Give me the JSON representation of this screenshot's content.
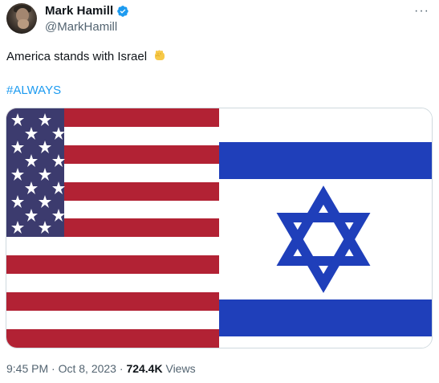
{
  "user": {
    "display_name": "Mark Hamill",
    "handle": "@MarkHamill",
    "verified_icon": "verified-badge-icon"
  },
  "tweet": {
    "text": "America stands with Israel",
    "emoji": "raised-fist-emoji",
    "hashtag": "#ALWAYS"
  },
  "more_menu": {
    "label": "···"
  },
  "media": {
    "left_image": "us-flag",
    "right_image": "israel-flag"
  },
  "meta": {
    "time": "9:45 PM",
    "separator": "·",
    "date": "Oct 8, 2023",
    "views_count": "724.4K",
    "views_label": "Views"
  },
  "colors": {
    "verified_blue": "#1d9bf0",
    "hashtag_blue": "#1d9bf0",
    "us_red": "#b22234",
    "us_blue": "#3c3b6e",
    "israel_blue": "#1f3fba",
    "secondary_text": "#536471"
  }
}
